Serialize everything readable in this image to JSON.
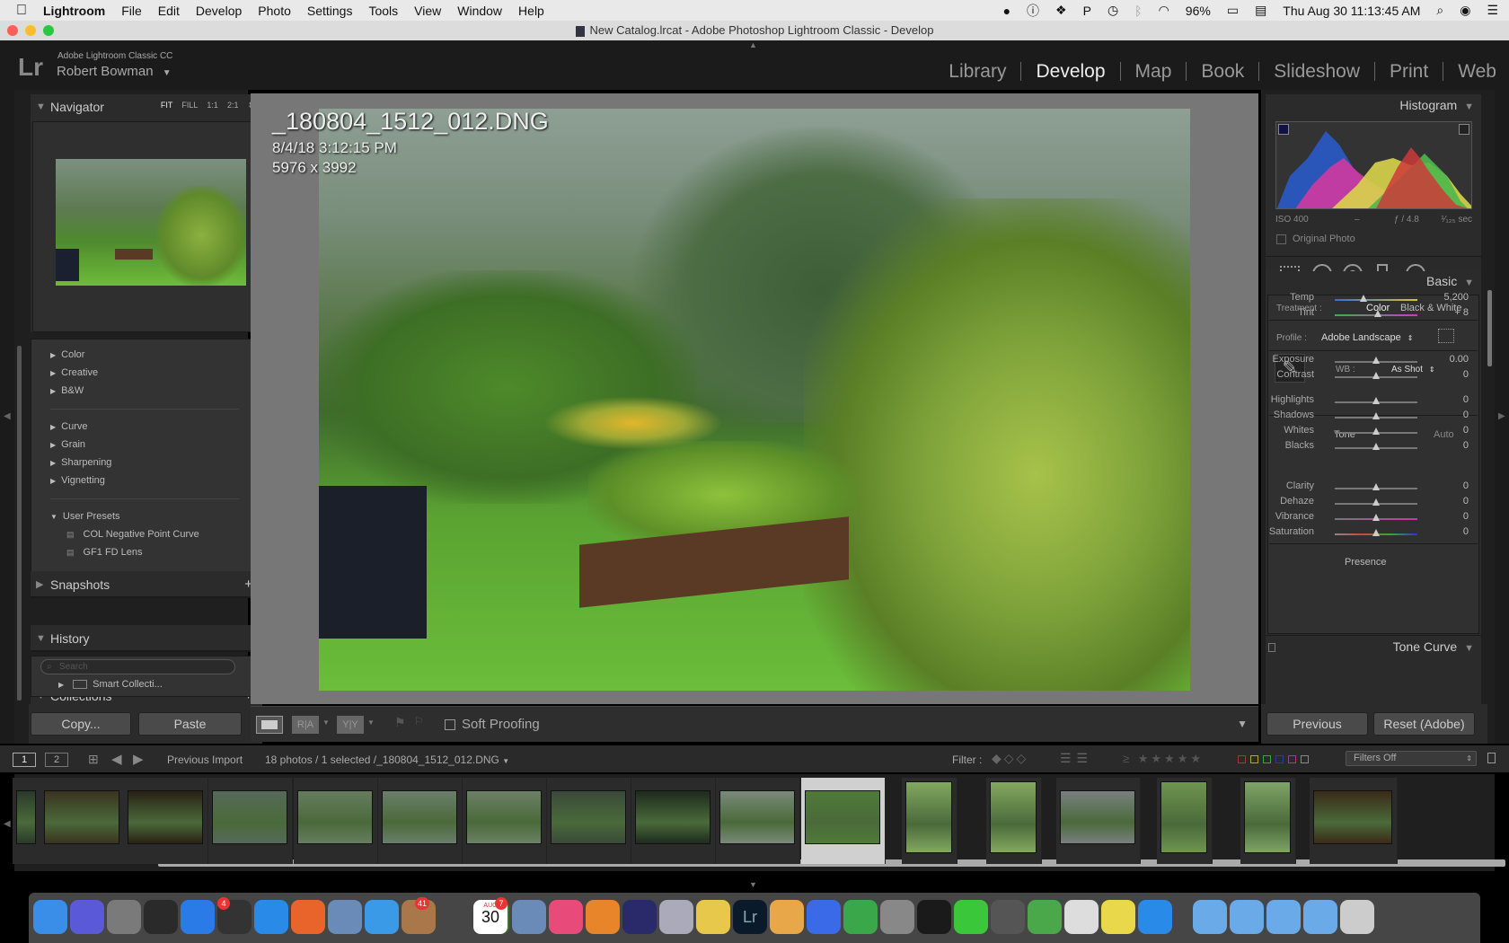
{
  "menubar": {
    "app": "Lightroom",
    "items": [
      "File",
      "Edit",
      "Develop",
      "Photo",
      "Settings",
      "Tools",
      "View",
      "Window",
      "Help"
    ],
    "battery": "96%",
    "datetime": "Thu Aug 30  11:13:45 AM"
  },
  "window": {
    "title": "New Catalog.lrcat - Adobe Photoshop Lightroom Classic - Develop"
  },
  "identity": {
    "product": "Adobe Lightroom Classic CC",
    "user": "Robert Bowman"
  },
  "modules": [
    "Library",
    "Develop",
    "Map",
    "Book",
    "Slideshow",
    "Print",
    "Web"
  ],
  "navigator": {
    "title": "Navigator",
    "zooms": [
      "FIT",
      "FILL",
      "1:1",
      "2:1"
    ]
  },
  "presets": {
    "groups1": [
      "Color",
      "Creative",
      "B&W"
    ],
    "groups2": [
      "Curve",
      "Grain",
      "Sharpening",
      "Vignetting"
    ],
    "user_title": "User Presets",
    "user_items": [
      "COL Negative Point Curve",
      "GF1 FD Lens"
    ]
  },
  "left_panels": {
    "snapshots": "Snapshots",
    "history": "History",
    "collections": "Collections",
    "search_placeholder": "Search",
    "smart": "Smart Collecti..."
  },
  "left_buttons": {
    "copy": "Copy...",
    "paste": "Paste"
  },
  "photo_info": {
    "filename": "_180804_1512_012.DNG",
    "datetime": "8/4/18 3:12:15 PM",
    "dims": "5976 x 3992"
  },
  "toolbar": {
    "soft_proofing": "Soft Proofing"
  },
  "histogram": {
    "title": "Histogram",
    "iso": "ISO 400",
    "dash": "–",
    "fstop": "ƒ / 4.8",
    "shutter": "¹⁄₁₂₅ sec",
    "original": "Original Photo"
  },
  "basic": {
    "title": "Basic",
    "treatment_label": "Treatment :",
    "color": "Color",
    "bw": "Black & White",
    "profile_label": "Profile :",
    "profile": "Adobe Landscape",
    "wb_label": "WB :",
    "wb": "As Shot",
    "tone": "Tone",
    "auto": "Auto",
    "presence": "Presence",
    "sliders": [
      {
        "label": "Temp",
        "value": "5,200",
        "pos": 0.35
      },
      {
        "label": "Tint",
        "value": "+ 8",
        "pos": 0.52
      },
      {
        "label": "Exposure",
        "value": "0.00",
        "pos": 0.5
      },
      {
        "label": "Contrast",
        "value": "0",
        "pos": 0.5
      },
      {
        "label": "Highlights",
        "value": "0",
        "pos": 0.5
      },
      {
        "label": "Shadows",
        "value": "0",
        "pos": 0.5
      },
      {
        "label": "Whites",
        "value": "0",
        "pos": 0.5
      },
      {
        "label": "Blacks",
        "value": "0",
        "pos": 0.5
      },
      {
        "label": "Clarity",
        "value": "0",
        "pos": 0.5
      },
      {
        "label": "Dehaze",
        "value": "0",
        "pos": 0.5
      },
      {
        "label": "Vibrance",
        "value": "0",
        "pos": 0.5
      },
      {
        "label": "Saturation",
        "value": "0",
        "pos": 0.5
      }
    ]
  },
  "tone_curve": "Tone Curve",
  "right_buttons": {
    "previous": "Previous",
    "reset": "Reset (Adobe)"
  },
  "filmstrip": {
    "pages": [
      "1",
      "2"
    ],
    "source": "Previous Import",
    "count": "18 photos / 1 selected /",
    "selected": "_180804_1512_012.DNG",
    "filter_label": "Filter :",
    "filter_value": "Filters Off"
  },
  "dock": {
    "calendar_day": "30",
    "calendar_month": "AUG",
    "badge1": "4",
    "badge2": "41",
    "badge3": "7"
  }
}
